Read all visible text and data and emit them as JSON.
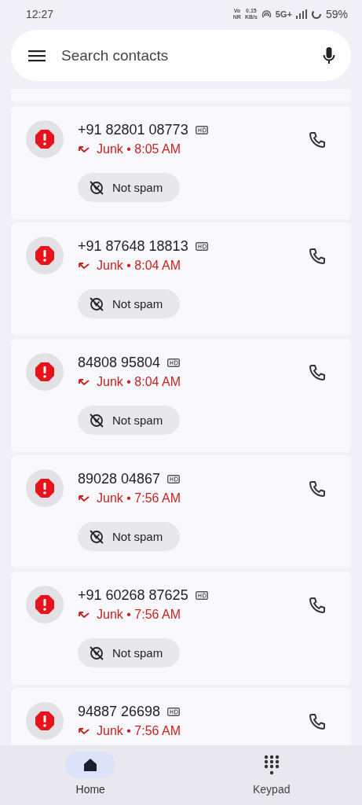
{
  "status_bar": {
    "time": "12:27",
    "volte": [
      "Vo",
      "NR"
    ],
    "speed": [
      "0.15",
      "KB/s"
    ],
    "network": "5G+",
    "battery": "59%"
  },
  "search": {
    "placeholder": "Search contacts"
  },
  "calls": [
    {
      "number": "+91 82801 08773",
      "hd": true,
      "status": "Junk • 8:05 AM",
      "action": "Not spam"
    },
    {
      "number": "+91 87648 18813",
      "hd": true,
      "status": "Junk • 8:04 AM",
      "action": "Not spam"
    },
    {
      "number": "84808 95804",
      "hd": true,
      "status": "Junk • 8:04 AM",
      "action": "Not spam"
    },
    {
      "number": "89028 04867",
      "hd": true,
      "status": "Junk • 7:56 AM",
      "action": "Not spam"
    },
    {
      "number": "+91 60268 87625",
      "hd": true,
      "status": "Junk • 7:56 AM",
      "action": "Not spam"
    },
    {
      "number": "94887 26698",
      "hd": true,
      "status": "Junk • 7:56 AM"
    }
  ],
  "nav": [
    {
      "label": "Home",
      "kind": "home",
      "selected": true
    },
    {
      "label": "Keypad",
      "kind": "keypad",
      "selected": false
    }
  ]
}
